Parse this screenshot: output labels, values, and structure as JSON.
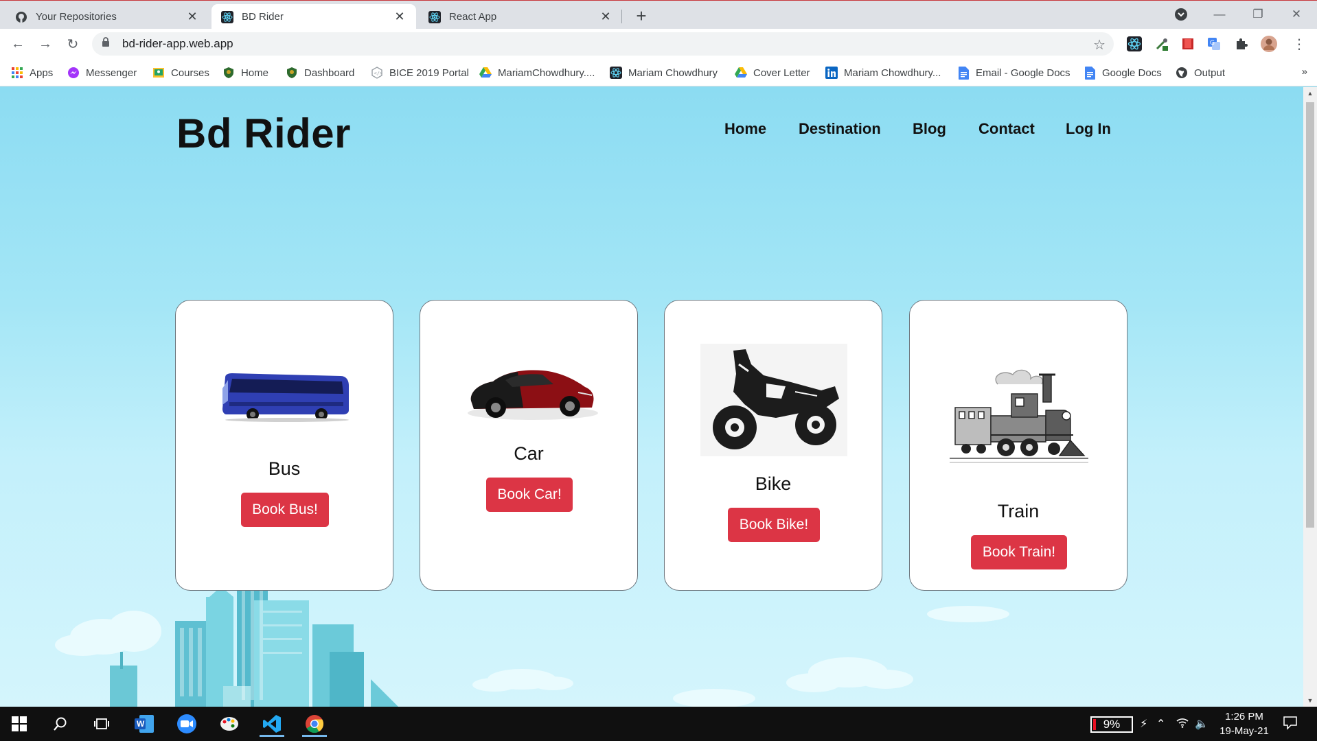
{
  "browser": {
    "tabs": [
      {
        "title": "Your Repositories",
        "icon": "github-icon"
      },
      {
        "title": "BD Rider",
        "icon": "react-icon"
      },
      {
        "title": "React App",
        "icon": "react-icon"
      }
    ],
    "url": "bd-rider-app.web.app",
    "bookmarks": [
      {
        "label": "Apps",
        "icon": "apps-grid-icon"
      },
      {
        "label": "Messenger",
        "icon": "messenger-icon"
      },
      {
        "label": "Courses",
        "icon": "classroom-icon"
      },
      {
        "label": "Home",
        "icon": "school-shield-icon"
      },
      {
        "label": "Dashboard",
        "icon": "school-shield-icon"
      },
      {
        "label": "BICE 2019 Portal",
        "icon": "code-hexagon-icon"
      },
      {
        "label": "MariamChowdhury....",
        "icon": "google-drive-icon"
      },
      {
        "label": "Mariam Chowdhury",
        "icon": "react-icon"
      },
      {
        "label": "Cover Letter",
        "icon": "google-drive-icon"
      },
      {
        "label": "Mariam Chowdhury...",
        "icon": "linkedin-icon"
      },
      {
        "label": "Email - Google Docs",
        "icon": "google-docs-icon"
      },
      {
        "label": "Google Docs",
        "icon": "google-docs-icon"
      },
      {
        "label": "Output",
        "icon": "globe-icon"
      }
    ],
    "bookmarks_more": "»"
  },
  "site": {
    "logo": "Bd Rider",
    "nav": [
      "Home",
      "Destination",
      "Blog",
      "Contact",
      "Log In"
    ],
    "vehicles": [
      {
        "name": "Bus",
        "button": "Book Bus!",
        "image": "bus-image"
      },
      {
        "name": "Car",
        "button": "Book Car!",
        "image": "car-image"
      },
      {
        "name": "Bike",
        "button": "Book Bike!",
        "image": "motorbike-image"
      },
      {
        "name": "Train",
        "button": "Book Train!",
        "image": "steam-train-image"
      }
    ],
    "button_color": "#dc3545",
    "background_color": "#8fe0f3"
  },
  "taskbar": {
    "battery": "9%",
    "time": "1:26 PM",
    "date": "19-May-21",
    "apps": [
      "windows-start-icon",
      "search-icon",
      "task-view-icon",
      "word-icon",
      "zoom-icon",
      "paint-icon",
      "vscode-icon",
      "chrome-icon"
    ]
  }
}
